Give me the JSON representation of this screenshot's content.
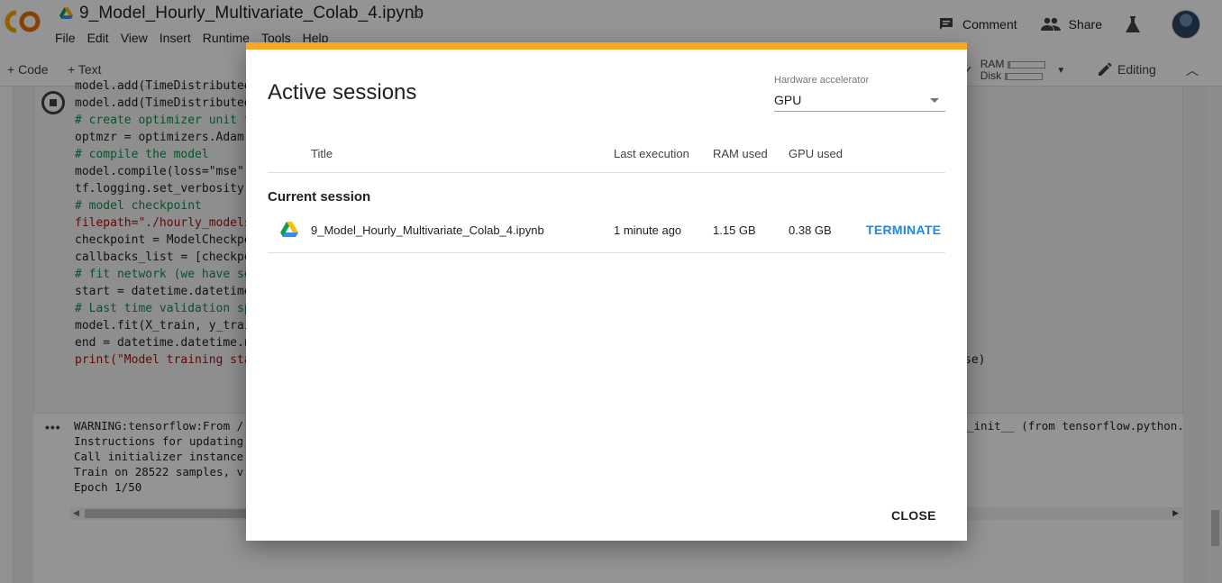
{
  "header": {
    "notebook_title": "9_Model_Hourly_Multivariate_Colab_4.ipynb",
    "menu": [
      "File",
      "Edit",
      "View",
      "Insert",
      "Runtime",
      "Tools",
      "Help"
    ],
    "comment_label": "Comment",
    "share_label": "Share"
  },
  "toolbar": {
    "code_label": "Code",
    "text_label": "Text",
    "ram_label": "RAM",
    "disk_label": "Disk",
    "ram_fill": 0.05,
    "disk_fill": 0.05,
    "editing_label": "Editing"
  },
  "code_lines": [
    "model.add(TimeDistributed",
    "model.add(TimeDistributed",
    "# create optimizer unit t",
    "optmzr = optimizers.Adam(",
    "# compile the model",
    "model.compile(loss=\"mse\",",
    "tf.logging.set_verbosity(",
    "",
    "# model checkpoint",
    "filepath=\"./hourly_models",
    "checkpoint = ModelCheckpo",
    "callbacks_list = [checkpo",
    "",
    "# fit network (we have se",
    "start = datetime.datetime",
    "# Last time validation sp",
    "model.fit(X_train, y_trai",
    "end = datetime.datetime.n",
    "print(\"Model training sta"
  ],
  "code_tail": "se)",
  "output_lines": [
    "WARNING:tensorflow:From /",
    "Instructions for updating",
    "Call initializer instance",
    "Train on 28522 samples, v",
    "Epoch 1/50"
  ],
  "output_tail": "_init__ (from tensorflow.python.",
  "dialog": {
    "title": "Active sessions",
    "hw_label": "Hardware accelerator",
    "hw_value": "GPU",
    "columns": {
      "title": "Title",
      "last_execution": "Last execution",
      "ram_used": "RAM used",
      "gpu_used": "GPU used"
    },
    "section": "Current session",
    "session": {
      "title": "9_Model_Hourly_Multivariate_Colab_4.ipynb",
      "last_execution": "1 minute ago",
      "ram_used": "1.15 GB",
      "gpu_used": "0.38 GB",
      "action": "TERMINATE"
    },
    "close_label": "CLOSE"
  },
  "colors": {
    "accent_bar": "#f9a825",
    "link_blue": "#1e88e5"
  }
}
